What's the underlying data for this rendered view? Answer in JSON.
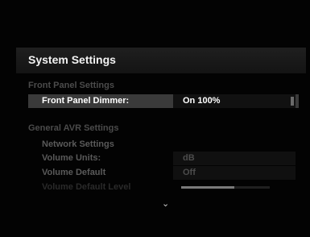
{
  "page": {
    "title": "System Settings"
  },
  "sections": {
    "front_panel": {
      "label": "Front Panel Settings",
      "rows": {
        "dimmer": {
          "label": "Front Panel Dimmer:",
          "value": "On 100%"
        }
      }
    },
    "general_avr": {
      "label": "General AVR Settings",
      "rows": {
        "network": {
          "label": "Network Settings"
        },
        "volume_units": {
          "label": "Volume Units:",
          "value": "dB"
        },
        "volume_default": {
          "label": "Volume Default",
          "value": "Off"
        },
        "volume_default_level": {
          "label": "Volume Default Level",
          "level": 0.6
        }
      }
    }
  },
  "icons": {
    "scroll_down": "chevron-down-icon"
  },
  "colors": {
    "background": "#030303",
    "selected_row": "#3a3a3a",
    "title_bar": "#1a1a1a",
    "muted_text": "#4b4b4b"
  }
}
